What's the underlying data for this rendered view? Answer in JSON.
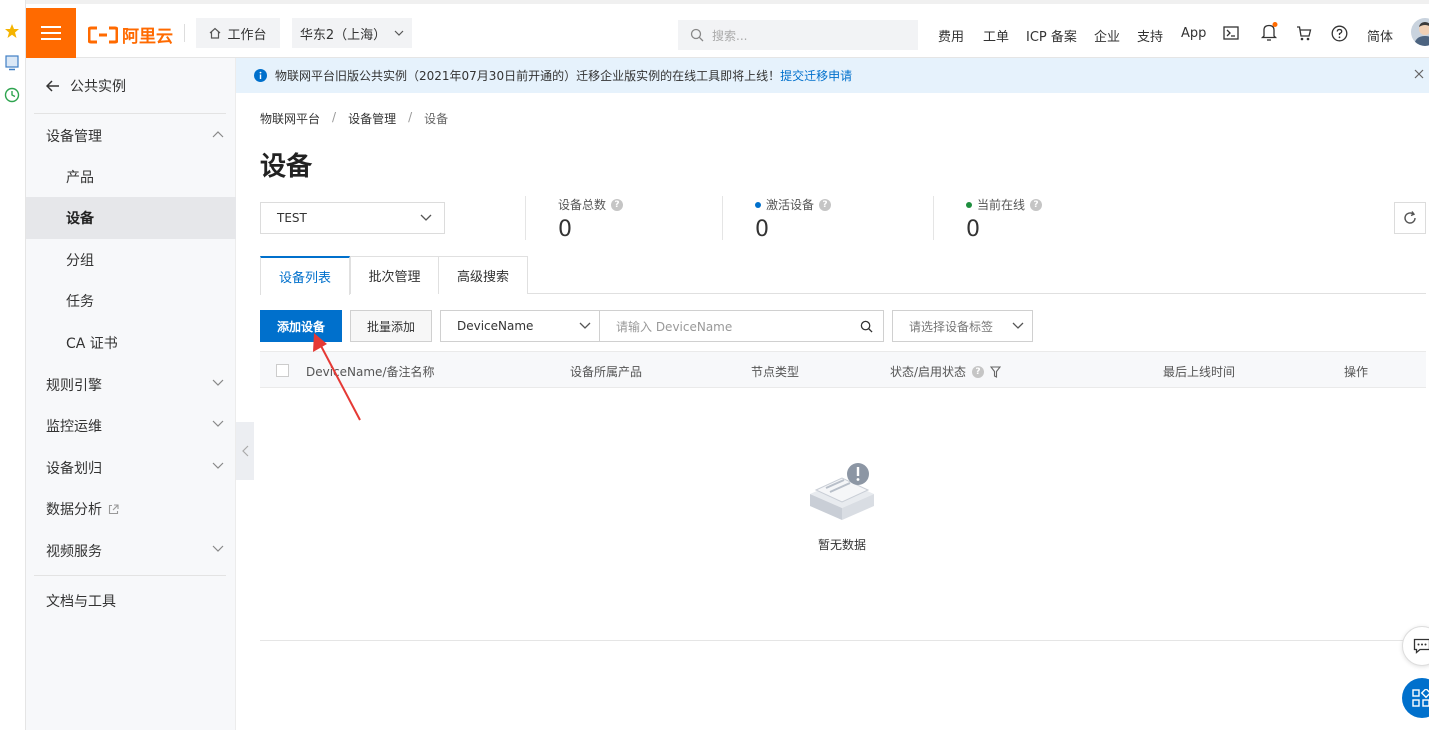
{
  "topbar": {
    "logo_text": "阿里云",
    "workbench_label": "工作台",
    "region_label": "华东2（上海）",
    "search_placeholder": "搜索...",
    "nav": [
      "费用",
      "工单",
      "ICP 备案",
      "企业",
      "支持",
      "App"
    ],
    "lang_label": "简体",
    "accent_color": "#ff6a00"
  },
  "sidebar": {
    "back_label": "公共实例",
    "group_label": "设备管理",
    "sub_items": [
      "产品",
      "设备",
      "分组",
      "任务",
      "CA 证书"
    ],
    "active_item": "设备",
    "sections": [
      "规则引擎",
      "监控运维",
      "设备划归",
      "数据分析",
      "视频服务"
    ],
    "docs_label": "文档与工具"
  },
  "notice": {
    "text": "物联网平台旧版公共实例（2021年07月30日前开通的）迁移企业版实例的在线工具即将上线！",
    "link": "提交迁移申请"
  },
  "breadcrumb": [
    "物联网平台",
    "设备管理",
    "设备"
  ],
  "page_title": "设备",
  "product_select": "TEST",
  "stats": [
    {
      "label": "设备总数",
      "value": "0",
      "dot_color": ""
    },
    {
      "label": "激活设备",
      "value": "0",
      "dot_color": "#0070cc"
    },
    {
      "label": "当前在线",
      "value": "0",
      "dot_color": "#1e8e3e"
    }
  ],
  "tabs": [
    "设备列表",
    "批次管理",
    "高级搜索"
  ],
  "active_tab": "设备列表",
  "toolbar": {
    "add_label": "添加设备",
    "batch_add_label": "批量添加",
    "field_select": "DeviceName",
    "search_placeholder": "请输入 DeviceName",
    "tag_placeholder": "请选择设备标签"
  },
  "table": {
    "columns": [
      "DeviceName/备注名称",
      "设备所属产品",
      "节点类型",
      "状态/启用状态",
      "最后上线时间",
      "操作"
    ],
    "empty_text": "暂无数据"
  },
  "primary_color": "#0070cc"
}
